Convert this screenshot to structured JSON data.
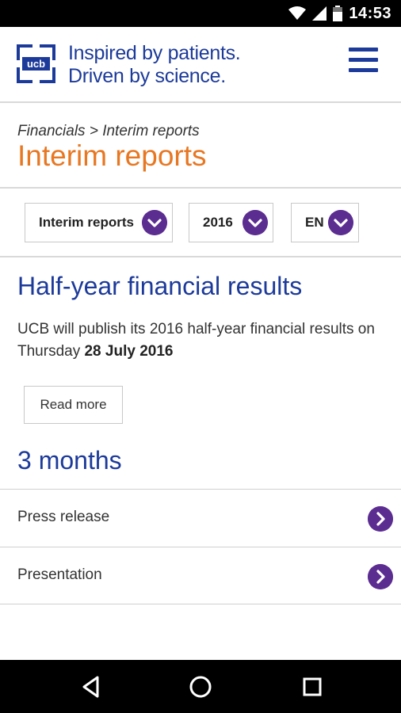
{
  "status_bar": {
    "time": "14:53",
    "icons": [
      "wifi-icon",
      "signal-icon",
      "battery-icon"
    ]
  },
  "header": {
    "logo_text": "ucb",
    "tagline_line1_light": "Inspired by ",
    "tagline_line1_strong": "patients.",
    "tagline_line2_light": "Driven by ",
    "tagline_line2_strong": "science.",
    "menu_icon": "hamburger-menu-icon"
  },
  "breadcrumb": {
    "items": [
      "Financials",
      "Interim reports"
    ],
    "separator": " > "
  },
  "page_title": "Interim reports",
  "filters": {
    "report_type": "Interim reports",
    "year": "2016",
    "language": "EN"
  },
  "announcement": {
    "heading": "Half-year financial results",
    "text_prefix": "UCB will publish its 2016 half-year financial results on Thursday ",
    "text_date": "28 July 2016",
    "button_label": "Read more"
  },
  "section": {
    "heading": "3 months",
    "items": [
      {
        "label": "Press release"
      },
      {
        "label": "Presentation"
      }
    ]
  },
  "colors": {
    "brand_blue": "#1c3a9a",
    "title_orange": "#e87722",
    "accent_purple": "#5c2d91"
  }
}
